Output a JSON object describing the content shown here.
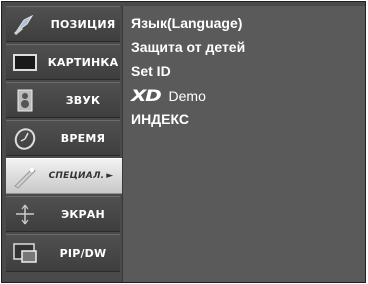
{
  "sidebar": {
    "items": [
      {
        "label": "ПОЗИЦИЯ",
        "icon": "position-icon"
      },
      {
        "label": "КАРТИНКА",
        "icon": "picture-icon"
      },
      {
        "label": "ЗВУК",
        "icon": "speaker-icon"
      },
      {
        "label": "ВРЕМЯ",
        "icon": "clock-icon"
      },
      {
        "label": "СПЕЦИАЛ.",
        "icon": "special-icon",
        "selected": true
      },
      {
        "label": "ЭКРАН",
        "icon": "screen-adjust-icon"
      },
      {
        "label": "PIP/DW",
        "icon": "pip-icon"
      }
    ],
    "arrow": "►"
  },
  "submenu": {
    "options": [
      {
        "label": "Язык(Language)"
      },
      {
        "label": "Защита от детей"
      },
      {
        "label": "Set ID"
      },
      {
        "logo": "XD",
        "label": "Demo"
      },
      {
        "label": "ИНДЕКС"
      }
    ]
  }
}
